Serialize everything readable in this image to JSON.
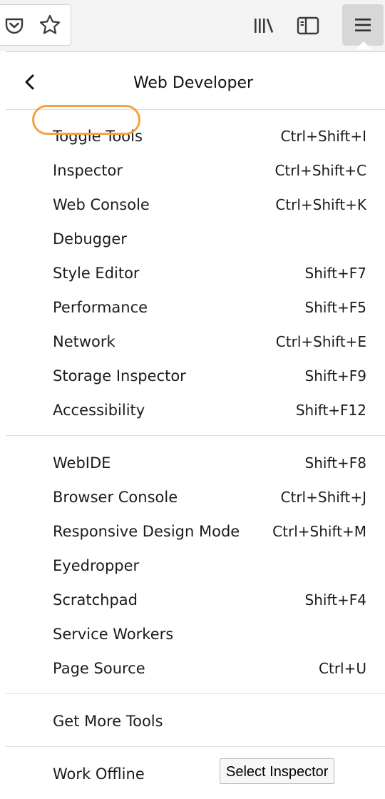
{
  "toolbar": {
    "icons": [
      "pocket-icon",
      "bookmark-star-icon",
      "library-icon",
      "sidebars-icon",
      "hamburger-menu-icon"
    ]
  },
  "panel": {
    "title": "Web Developer",
    "back_icon": "chevron-left-icon",
    "sections": [
      {
        "items": [
          {
            "label": "Toggle Tools",
            "shortcut": "Ctrl+Shift+I"
          },
          {
            "label": "Inspector",
            "shortcut": "Ctrl+Shift+C",
            "highlighted": true
          },
          {
            "label": "Web Console",
            "shortcut": "Ctrl+Shift+K"
          },
          {
            "label": "Debugger",
            "shortcut": ""
          },
          {
            "label": "Style Editor",
            "shortcut": "Shift+F7"
          },
          {
            "label": "Performance",
            "shortcut": "Shift+F5"
          },
          {
            "label": "Network",
            "shortcut": "Ctrl+Shift+E"
          },
          {
            "label": "Storage Inspector",
            "shortcut": "Shift+F9"
          },
          {
            "label": "Accessibility",
            "shortcut": "Shift+F12"
          }
        ]
      },
      {
        "items": [
          {
            "label": "WebIDE",
            "shortcut": "Shift+F8"
          },
          {
            "label": "Browser Console",
            "shortcut": "Ctrl+Shift+J"
          },
          {
            "label": "Responsive Design Mode",
            "shortcut": "Ctrl+Shift+M"
          },
          {
            "label": "Eyedropper",
            "shortcut": ""
          },
          {
            "label": "Scratchpad",
            "shortcut": "Shift+F4"
          },
          {
            "label": "Service Workers",
            "shortcut": ""
          },
          {
            "label": "Page Source",
            "shortcut": "Ctrl+U"
          }
        ]
      },
      {
        "items": [
          {
            "label": "Get More Tools",
            "shortcut": ""
          }
        ]
      },
      {
        "items": [
          {
            "label": "Work Offline",
            "shortcut": ""
          }
        ]
      }
    ]
  },
  "tooltip": {
    "text": "Select Inspector"
  },
  "colors": {
    "highlight_ring": "#f5a13c",
    "toolbar_bg": "#f3f3f3",
    "active_button_bg": "#d7d7d7"
  }
}
